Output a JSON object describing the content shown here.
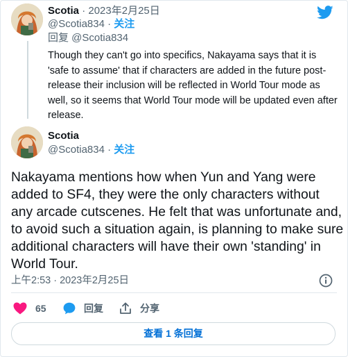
{
  "colors": {
    "accent": "#1d9bf0",
    "like": "#f91880",
    "text": "#0f1419",
    "muted": "#536471",
    "border": "#cfd9de"
  },
  "reply_tweet": {
    "name": "Scotia",
    "separator": "·",
    "date": "2023年2月25日",
    "handle": "@Scotia834",
    "dot": "·",
    "follow": "关注",
    "reply_to": "回复 @Scotia834",
    "text": "Though they can't go into specifics, Nakayama says that it is 'safe to assume' that if characters are added in the future post-release their inclusion will be reflected in World Tour mode as well, so it seems that World Tour mode will be updated even after release."
  },
  "main_tweet": {
    "name": "Scotia",
    "handle": "@Scotia834",
    "dot": "·",
    "follow": "关注",
    "text": "Nakayama mentions how when Yun and Yang were added to SF4, they were the only characters without any arcade cutscenes. He felt that was unfortunate and, to avoid such a situation again, is planning to make sure additional characters will have their own 'standing' in World Tour.",
    "timestamp": "上午2:53 · 2023年2月25日"
  },
  "actions": {
    "like_count": "65",
    "reply_label": "回复",
    "share_label": "分享"
  },
  "view_replies": "查看 1 条回复",
  "icons": {
    "brand": "twitter-bird-icon",
    "info": "info-icon",
    "like": "heart-icon",
    "reply": "speech-bubble-icon",
    "share": "share-icon"
  }
}
